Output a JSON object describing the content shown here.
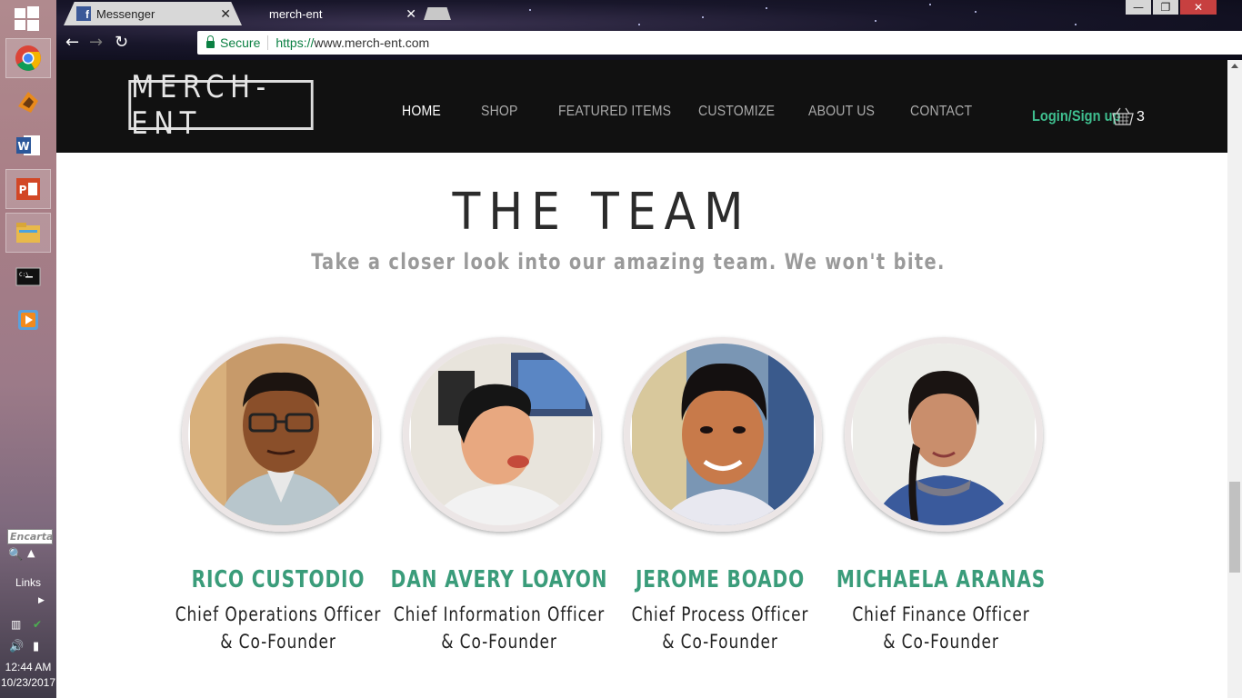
{
  "taskbar": {
    "apps": [
      "chrome-icon",
      "winamp-icon",
      "word-icon",
      "powerpoint-icon",
      "file-explorer-icon",
      "command-prompt-icon",
      "media-player-icon"
    ],
    "encarta_placeholder": "Encarta",
    "links_label": "Links",
    "time": "12:44 AM",
    "date": "10/23/2017"
  },
  "browser": {
    "tabs": [
      {
        "title": "Messenger",
        "active": false
      },
      {
        "title": "merch-ent",
        "active": true
      }
    ],
    "secure_label": "Secure",
    "url_scheme": "https://",
    "url_host": "www.merch-ent.com"
  },
  "site": {
    "logo": "MERCH-ENT",
    "nav": [
      "HOME",
      "SHOP",
      "FEATURED ITEMS",
      "CUSTOMIZE",
      "ABOUT US",
      "CONTACT"
    ],
    "login_label": "Login/Sign up",
    "cart_count": "3",
    "accent_color": "#3a9c7a",
    "team": {
      "title": "THE TEAM",
      "subtitle": "Take a closer look into our amazing team. We won't bite.",
      "members": [
        {
          "name": "RICO CUSTODIO",
          "role_line1": "Chief Operations Officer",
          "role_line2": "& Co-Founder"
        },
        {
          "name": "DAN AVERY LOAYON",
          "role_line1": "Chief Information Officer",
          "role_line2": "& Co-Founder"
        },
        {
          "name": "JEROME BOADO",
          "role_line1": "Chief Process Officer",
          "role_line2": "& Co-Founder"
        },
        {
          "name": "MICHAELA ARANAS",
          "role_line1": "Chief Finance Officer",
          "role_line2": "& Co-Founder"
        }
      ]
    }
  }
}
